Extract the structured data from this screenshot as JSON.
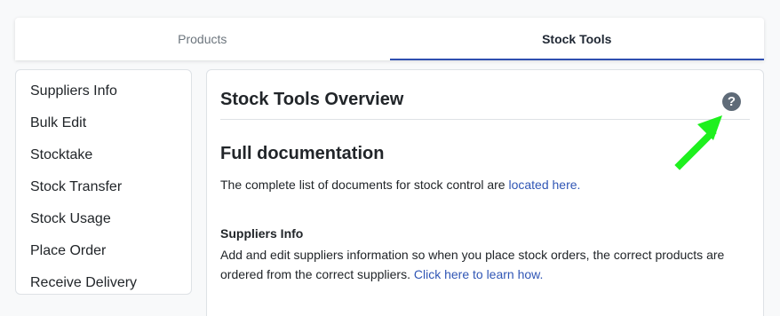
{
  "tabs": [
    {
      "label": "Products",
      "active": false
    },
    {
      "label": "Stock Tools",
      "active": true
    }
  ],
  "sidebar": {
    "items": [
      {
        "label": "Suppliers Info"
      },
      {
        "label": "Bulk Edit"
      },
      {
        "label": "Stocktake"
      },
      {
        "label": "Stock Transfer"
      },
      {
        "label": "Stock Usage"
      },
      {
        "label": "Place Order"
      },
      {
        "label": "Receive Delivery"
      }
    ]
  },
  "main": {
    "title": "Stock Tools Overview",
    "help_icon": "question-circle-icon",
    "docs_heading": "Full documentation",
    "docs_text": "The complete list of documents for stock control are ",
    "docs_link": "located here.",
    "suppliers_heading": "Suppliers Info",
    "suppliers_text": "Add and edit suppliers information so when you place stock orders, the correct products are ordered from the correct suppliers. ",
    "suppliers_link": "Click here to learn how."
  },
  "annotation": {
    "arrow_icon": "pointer-arrow-icon",
    "arrow_color": "#1ef01e"
  },
  "colors": {
    "accent": "#2f4fb0",
    "link": "#3056b5",
    "help_icon_bg": "#5f6b78"
  }
}
